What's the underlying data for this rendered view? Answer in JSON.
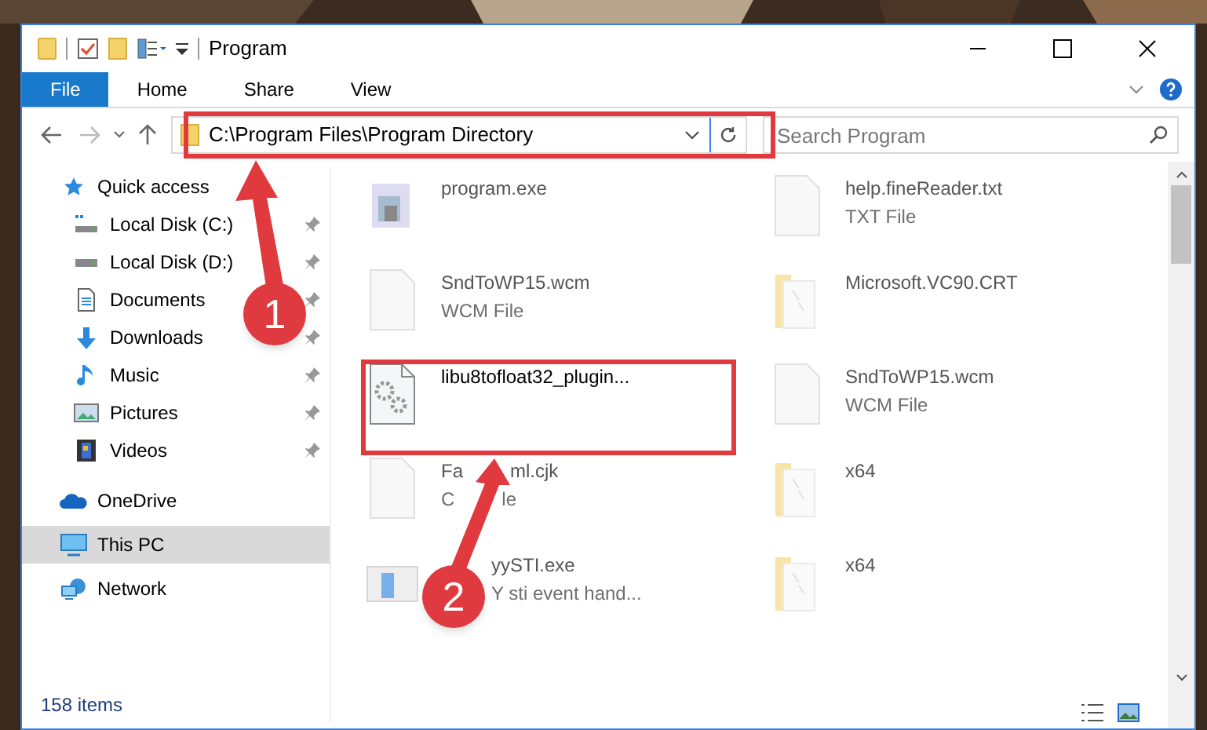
{
  "window": {
    "title": "Program"
  },
  "ribbon_tabs": [
    {
      "label": "File",
      "selected": true
    },
    {
      "label": "Home",
      "selected": false
    },
    {
      "label": "Share",
      "selected": false
    },
    {
      "label": "View",
      "selected": false
    }
  ],
  "address_bar": {
    "path": "C:\\Program Files\\Program Directory"
  },
  "search": {
    "placeholder": "Search Program"
  },
  "sidebar": {
    "items": [
      {
        "label": "Quick access",
        "kind": "quick",
        "selected": false,
        "pinned": false,
        "children": [
          {
            "label": "Local Disk (C:)",
            "kind": "diskc",
            "selected": false,
            "pinned": true
          },
          {
            "label": "Local Disk (D:)",
            "kind": "disk",
            "selected": false,
            "pinned": true
          },
          {
            "label": "Documents",
            "kind": "docs",
            "selected": false,
            "pinned": true
          },
          {
            "label": "Downloads",
            "kind": "down",
            "selected": false,
            "pinned": true
          },
          {
            "label": "Music",
            "kind": "music",
            "selected": false,
            "pinned": true
          },
          {
            "label": "Pictures",
            "kind": "pics",
            "selected": false,
            "pinned": true
          },
          {
            "label": "Videos",
            "kind": "video",
            "selected": false,
            "pinned": true
          }
        ]
      },
      {
        "label": "OneDrive",
        "kind": "cloud",
        "selected": false,
        "pinned": false
      },
      {
        "label": "This PC",
        "kind": "pc",
        "selected": true,
        "pinned": false
      },
      {
        "label": "Network",
        "kind": "net",
        "selected": false,
        "pinned": false
      }
    ]
  },
  "files": [
    {
      "name": [
        "program.exe"
      ],
      "kind": "exe",
      "dimmed": true,
      "hidden_start": false
    },
    {
      "name": [
        "help.fineReader.txt"
      ],
      "type": [
        "TXT File"
      ],
      "kind": "doc",
      "dimmed": true,
      "hidden_start": false
    },
    {
      "name": [
        "SndToWP15.wcm"
      ],
      "type": [
        "WCM File"
      ],
      "kind": "doc",
      "dimmed": true,
      "hidden_start": false
    },
    {
      "name": [
        "Microsoft.VC90.CRT"
      ],
      "kind": "folder",
      "dimmed": true,
      "hidden_start": false
    },
    {
      "name": [
        "libu8tofloat32_plugin..."
      ],
      "kind": "dll",
      "dimmed": false,
      "hidden_start": false
    },
    {
      "name": [
        "SndToWP15.wcm"
      ],
      "type": [
        "WCM File"
      ],
      "kind": "doc",
      "dimmed": true,
      "hidden_start": false
    },
    {
      "name": [
        "Fa",
        "ml.cjk"
      ],
      "type": [
        "C",
        "le"
      ],
      "kind": "doc",
      "dimmed": true,
      "hidden_start": false
    },
    {
      "name": [
        "x64"
      ],
      "kind": "folder",
      "dimmed": true,
      "hidden_start": false
    },
    {
      "name": [
        "yySTI.exe"
      ],
      "type": [
        "Y sti event hand..."
      ],
      "kind": "app",
      "dimmed": true,
      "hidden_start": true
    },
    {
      "name": [
        "x64"
      ],
      "kind": "folder",
      "dimmed": true,
      "hidden_start": false
    }
  ],
  "status_bar": {
    "count": "158 items"
  },
  "annotations": [
    {
      "number": "1"
    },
    {
      "number": "2"
    }
  ]
}
